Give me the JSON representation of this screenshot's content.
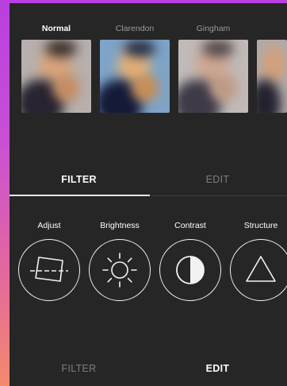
{
  "filters": [
    {
      "name": "Normal",
      "selected": true
    },
    {
      "name": "Clarendon",
      "selected": false
    },
    {
      "name": "Gingham",
      "selected": false
    },
    {
      "name": "",
      "selected": false
    }
  ],
  "top_tabs": {
    "filter": "FILTER",
    "edit": "EDIT",
    "active": "filter"
  },
  "tools": [
    {
      "label": "Adjust",
      "icon": "adjust-icon"
    },
    {
      "label": "Brightness",
      "icon": "sun-icon"
    },
    {
      "label": "Contrast",
      "icon": "contrast-icon"
    },
    {
      "label": "Structure",
      "icon": "triangle-icon"
    }
  ],
  "bottom_tabs": {
    "filter": "FILTER",
    "edit": "EDIT",
    "active": "edit"
  },
  "colors": {
    "background": "#262626",
    "accent": "#ffffff",
    "muted": "#7e7e7e"
  }
}
